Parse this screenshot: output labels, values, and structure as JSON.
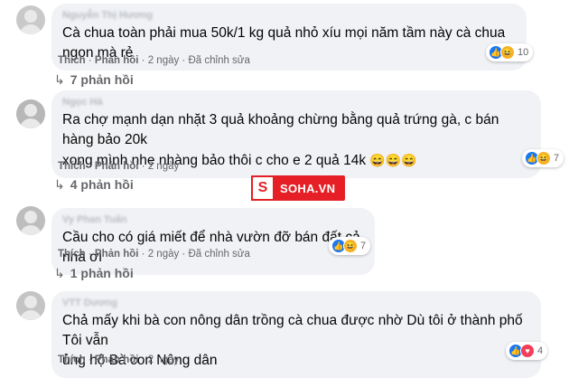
{
  "comments": [
    {
      "author": "Nguyễn Thị Hương",
      "text": "Cà chua toàn phải mua 50k/1 kg quả nhỏ xíu mọi năm tầm này cà chua ngon mà rẻ",
      "actions": {
        "like": "Thích",
        "reply": "Phản hồi",
        "time": "2 ngày",
        "edited": "Đã chỉnh sửa"
      },
      "reactions": {
        "icons": [
          "like-icon",
          "haha-icon"
        ],
        "count": "10"
      },
      "replies": "7 phản hồi"
    },
    {
      "author": "Ngọc Hà",
      "text_line1": "Ra chợ mạnh dạn nhặt 3 quả khoảng chừng bằng quả trứng gà, c bán hàng bảo 20k",
      "text_line2": "xong mình nhẹ nhàng bảo thôi c cho e 2 quả 14k",
      "emoji": "😄😄😄",
      "actions": {
        "like": "Thích",
        "reply": "Phản hồi",
        "time": "2 ngày"
      },
      "reactions": {
        "icons": [
          "like-icon",
          "haha-icon"
        ],
        "count": "7"
      },
      "replies": "4 phản hồi"
    },
    {
      "author": "Vy Phan Tuấn",
      "text": "Cầu cho có giá miết để nhà vườn đỡ bán đất cả nhà ơi",
      "actions": {
        "like": "Thích",
        "reply": "Phản hồi",
        "time": "2 ngày",
        "edited": "Đã chỉnh sửa"
      },
      "reactions": {
        "icons": [
          "like-icon",
          "haha-icon"
        ],
        "count": "7"
      },
      "replies": "1 phản hồi"
    },
    {
      "author": "VTT Dương",
      "text_line1": "Chả mấy khi bà con nông dân trồng cà chua được nhờ Dù tôi ở thành phố Tôi vẫn",
      "text_line2": "ủng hộ Bà con Nông dân",
      "actions": {
        "like": "Thích",
        "reply": "Phản hồi",
        "time": "2 ngày"
      },
      "reactions": {
        "icons": [
          "like-icon",
          "love-icon"
        ],
        "count": "4"
      }
    }
  ],
  "watermark": {
    "mark": "S",
    "text": "SOHA.VN"
  },
  "colors": {
    "bubble": "#f0f2f5",
    "meta": "#65676b",
    "like": "#1877f2",
    "watermark": "#e51f25"
  }
}
